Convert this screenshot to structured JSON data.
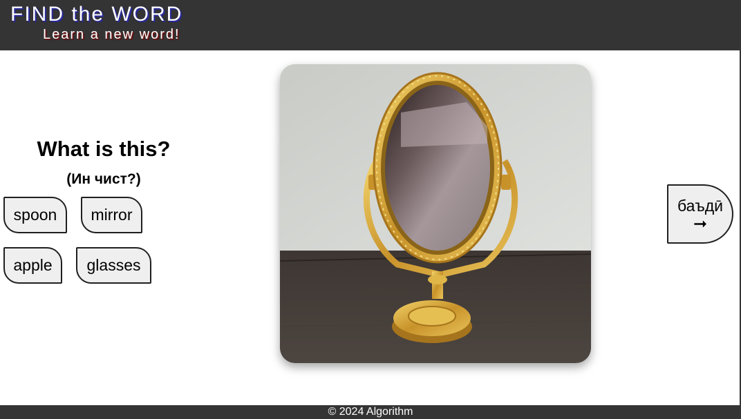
{
  "header": {
    "title": "FIND the WORD",
    "subtitle": "Learn a new word!"
  },
  "quiz": {
    "question": "What is this?",
    "question_translation": "(Ин чист?)",
    "choices": [
      {
        "label": "spoon"
      },
      {
        "label": "mirror"
      },
      {
        "label": "apple"
      },
      {
        "label": "glasses"
      }
    ]
  },
  "image": {
    "subject": "gold ornate oval table mirror"
  },
  "next": {
    "label": "баъдӣ",
    "arrow": "➞"
  },
  "footer": {
    "copyright": "© 2024 Algorithm"
  },
  "colors": {
    "header_bg": "#343434",
    "button_bg": "#efefef",
    "button_border": "#1f1f1f",
    "gold": "#d4a52a"
  }
}
